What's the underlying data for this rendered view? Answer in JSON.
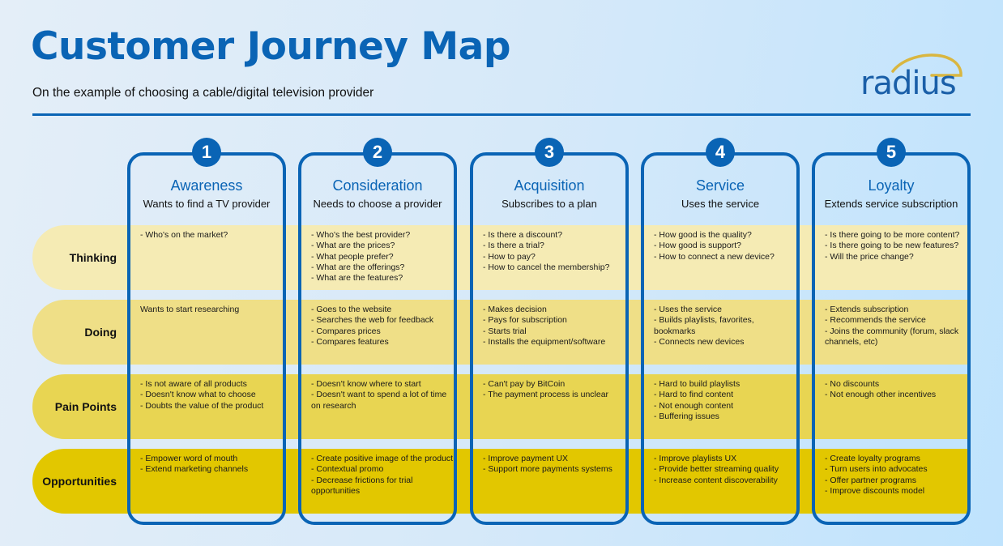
{
  "header": {
    "title": "Customer Journey Map",
    "subtitle": "On the example of choosing a cable/digital television provider",
    "logo_text": "radius"
  },
  "colors": {
    "brand_blue": "#0a64b5",
    "thinking_band": "#f5ebb4",
    "doing_band": "#efdf87",
    "pain_band": "#e8d552",
    "opportunities_band": "#e2c700"
  },
  "rows": [
    {
      "label": "Thinking"
    },
    {
      "label": "Doing"
    },
    {
      "label": "Pain Points"
    },
    {
      "label": "Opportunities"
    }
  ],
  "stages": [
    {
      "number": "1",
      "title": "Awareness",
      "subtitle": "Wants to find a TV provider",
      "thinking": [
        "- Who's on the market?"
      ],
      "doing": [
        "Wants to start researching"
      ],
      "pain_points": [
        "- Is not aware of all products",
        "- Doesn't know what to choose",
        "- Doubts the value of the product"
      ],
      "opportunities": [
        "- Empower word of mouth",
        "- Extend marketing channels"
      ]
    },
    {
      "number": "2",
      "title": "Consideration",
      "subtitle": "Needs to choose a provider",
      "thinking": [
        "- Who's the best provider?",
        "- What are the prices?",
        "- What people prefer?",
        "- What are the offerings?",
        "- What are the features?"
      ],
      "doing": [
        "- Goes to the website",
        "- Searches the web for feedback",
        "- Compares prices",
        "- Compares features"
      ],
      "pain_points": [
        "- Doesn't know where to start",
        "- Doesn't want to spend a lot of time on research"
      ],
      "opportunities": [
        "- Create positive image of the product",
        "- Contextual promo",
        "- Decrease frictions for trial opportunities"
      ]
    },
    {
      "number": "3",
      "title": "Acquisition",
      "subtitle": "Subscribes to a plan",
      "thinking": [
        "- Is there a discount?",
        "- Is there a trial?",
        "- How to pay?",
        "- How to cancel the membership?"
      ],
      "doing": [
        "- Makes decision",
        "- Pays for subscription",
        "- Starts trial",
        "- Installs the equipment/software"
      ],
      "pain_points": [
        "- Can't pay by BitCoin",
        "- The payment process is unclear"
      ],
      "opportunities": [
        "- Improve payment UX",
        "- Support more payments systems"
      ]
    },
    {
      "number": "4",
      "title": "Service",
      "subtitle": "Uses the service",
      "thinking": [
        "- How good is the quality?",
        "- How good is support?",
        "- How to connect a new device?"
      ],
      "doing": [
        "- Uses the service",
        "- Builds playlists, favorites, bookmarks",
        "- Connects new devices"
      ],
      "pain_points": [
        "- Hard to build playlists",
        "- Hard to find content",
        "- Not enough content",
        "- Buffering issues"
      ],
      "opportunities": [
        "- Improve playlists UX",
        "- Provide better streaming quality",
        "- Increase content discoverability"
      ]
    },
    {
      "number": "5",
      "title": "Loyalty",
      "subtitle": "Extends service subscription",
      "thinking": [
        "- Is there going to be more content?",
        "- Is there going to be new features?",
        "- Will the price change?"
      ],
      "doing": [
        "- Extends subscription",
        "- Recommends the service",
        "- Joins the community (forum, slack channels, etc)"
      ],
      "pain_points": [
        "- No discounts",
        "- Not enough other incentives"
      ],
      "opportunities": [
        "- Create loyalty programs",
        "- Turn users into advocates",
        "- Offer partner programs",
        "- Improve discounts model"
      ]
    }
  ]
}
